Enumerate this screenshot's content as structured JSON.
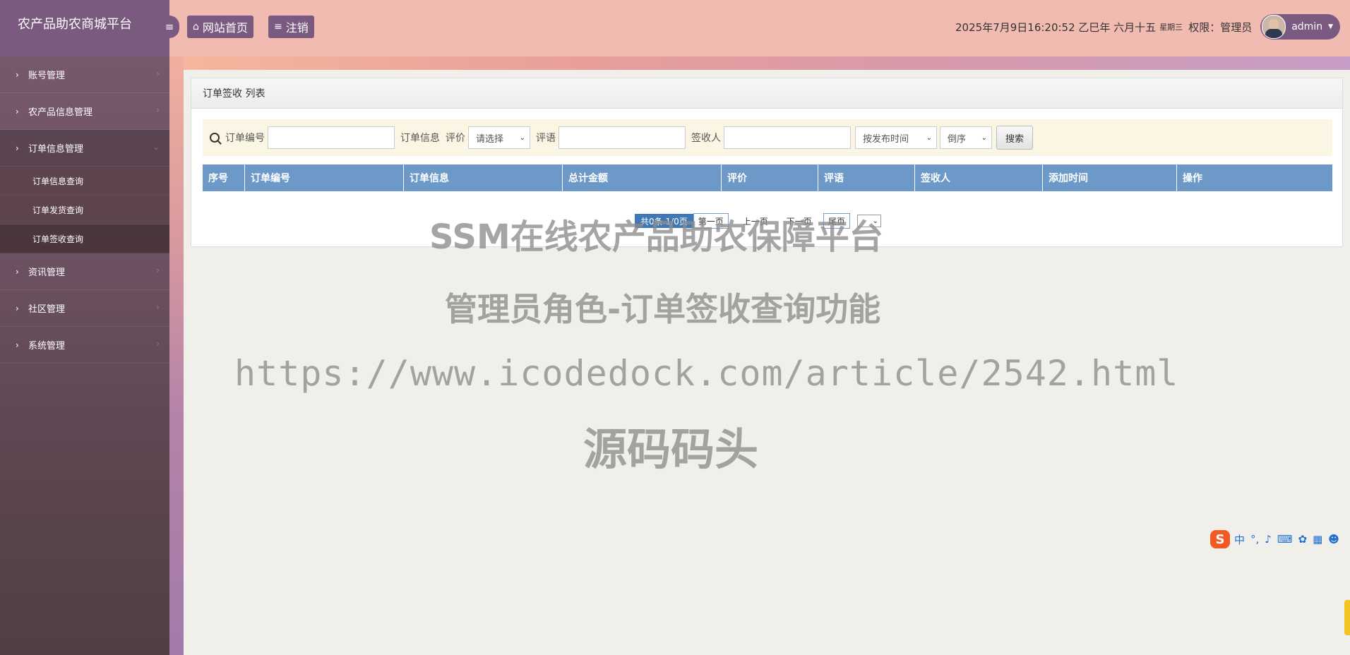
{
  "sidebar": {
    "brand": "农产品助农商城平台",
    "items": [
      {
        "label": "账号管理"
      },
      {
        "label": "农产品信息管理"
      },
      {
        "label": "订单信息管理"
      },
      {
        "label": "资讯管理"
      },
      {
        "label": "社区管理"
      },
      {
        "label": "系统管理"
      }
    ],
    "subitems": [
      {
        "label": "订单信息查询"
      },
      {
        "label": "订单发货查询"
      },
      {
        "label": "订单签收查询"
      }
    ]
  },
  "header": {
    "home_label": "网站首页",
    "logout_label": "注销",
    "datetime": "2025年7月9日16:20:52 乙巳年 六月十五",
    "weekday": "星期三",
    "role_label": "权限：管理员",
    "username": "admin"
  },
  "panel": {
    "title": "订单签收 列表",
    "search": {
      "order_no_label": "订单编号",
      "order_info_label": "订单信息",
      "rating_label": "评价",
      "rating_select": "请选择",
      "comment_label": "评语",
      "signer_label": "签收人",
      "sort_select": "按发布时间",
      "order_select": "倒序",
      "search_button": "搜索"
    },
    "columns": [
      "序号",
      "订单编号",
      "订单信息",
      "总计金额",
      "评价",
      "评语",
      "签收人",
      "添加时间",
      "操作"
    ],
    "pager": {
      "info": "共0条  1/0页",
      "first": "第一页",
      "prev": "上一页",
      "next": "下一页",
      "last": "尾页"
    }
  },
  "watermark": {
    "line1": "SSM在线农产品助农保障平台",
    "line2": "管理员角色-订单签收查询功能",
    "line3": "https://www.icodedock.com/article/2542.html",
    "line4": "源码码头"
  },
  "ime": {
    "logo": "S",
    "lang": "中"
  },
  "colors": {
    "sidebar_bg": "#7b5a80",
    "header_bg": "#f1bbb1",
    "table_head": "#6c99c7",
    "pager_info": "#3f79b5"
  }
}
